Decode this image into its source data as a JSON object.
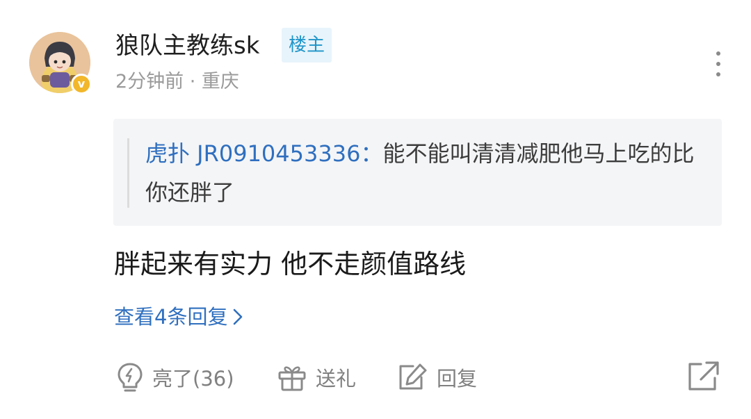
{
  "comment": {
    "author": {
      "name": "狼队主教练sk",
      "badge": "楼主",
      "avatar_icon": "avatar-image",
      "verified_icon": "verified-v-icon",
      "verified_glyph": "v"
    },
    "meta": "2分钟前 · 重庆",
    "quote": {
      "author": "虎扑 JR0910453336",
      "separator": "：",
      "text": "能不能叫清清减肥他马上吃的比你还胖了"
    },
    "content": "胖起来有实力 他不走颜值路线",
    "view_replies_label": "查看4条回复"
  },
  "actions": {
    "like_label": "亮了(36)",
    "gift_label": "送礼",
    "reply_label": "回复"
  },
  "colors": {
    "link": "#2f6fbf",
    "badge_text": "#1e95c9",
    "badge_bg": "#e8f4fb",
    "verified": "#f2b72a",
    "muted": "#9a9a9a",
    "quote_bg": "#f4f5f7"
  },
  "icons": {
    "more": "more-vertical-icon",
    "chevron": "chevron-right-icon",
    "like": "lightbulb-icon",
    "gift": "gift-icon",
    "reply": "edit-icon",
    "share": "share-icon"
  }
}
